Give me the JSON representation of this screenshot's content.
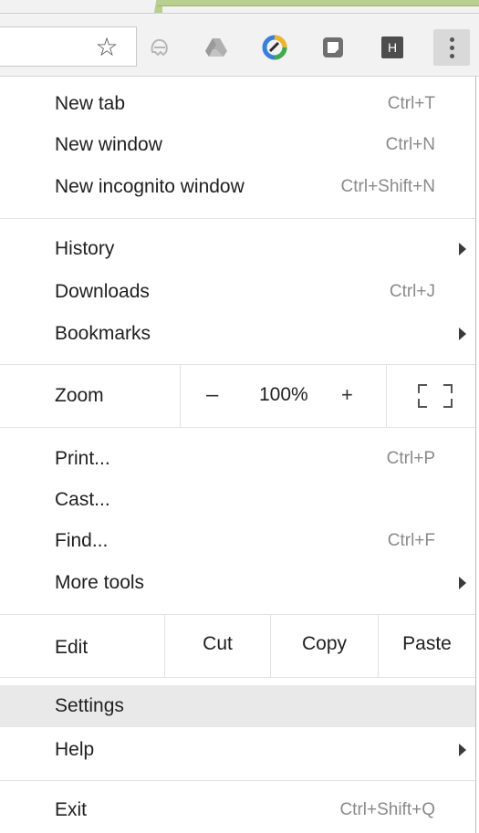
{
  "toolbar": {
    "bookmark_star": "☆",
    "extensions": [
      "ghost-extension-icon",
      "drive-icon",
      "ring-extension-icon",
      "note-extension-icon",
      "h-extension-icon"
    ],
    "ext_h_letter": "H"
  },
  "menu": {
    "new_tab": {
      "label": "New tab",
      "accel": "Ctrl+T"
    },
    "new_window": {
      "label": "New window",
      "accel": "Ctrl+N"
    },
    "new_incognito": {
      "label": "New incognito window",
      "accel": "Ctrl+Shift+N"
    },
    "history": {
      "label": "History"
    },
    "downloads": {
      "label": "Downloads",
      "accel": "Ctrl+J"
    },
    "bookmarks": {
      "label": "Bookmarks"
    },
    "zoom": {
      "label": "Zoom",
      "minus": "–",
      "level": "100%",
      "plus": "+"
    },
    "print": {
      "label": "Print...",
      "accel": "Ctrl+P"
    },
    "cast": {
      "label": "Cast..."
    },
    "find": {
      "label": "Find...",
      "accel": "Ctrl+F"
    },
    "more_tools": {
      "label": "More tools"
    },
    "edit": {
      "label": "Edit",
      "cut": "Cut",
      "copy": "Copy",
      "paste": "Paste"
    },
    "settings": {
      "label": "Settings"
    },
    "help": {
      "label": "Help"
    },
    "exit": {
      "label": "Exit",
      "accel": "Ctrl+Shift+Q"
    }
  },
  "colors": {
    "highlight": "#e9e9e9",
    "accel_text": "#8a8a8a",
    "tab_accent": "#b8cf8f"
  }
}
